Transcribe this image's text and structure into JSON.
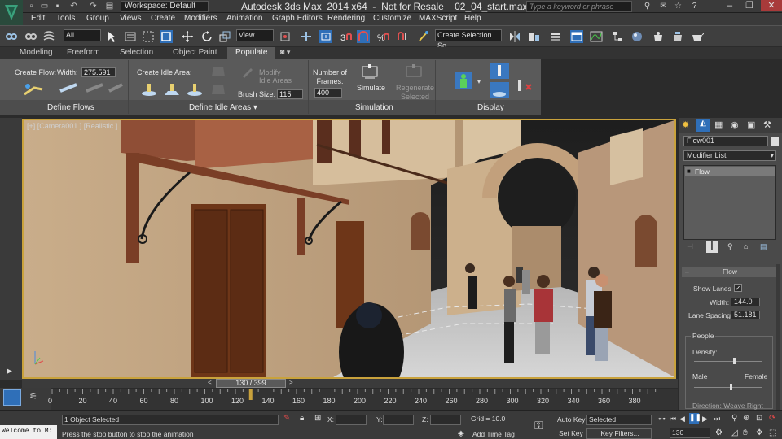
{
  "titlebar": {
    "title": "Autodesk 3ds Max  2014 x64  -  Not for Resale    02_04_start.max",
    "workspace": "Workspace: Default",
    "search_placeholder": "Type a keyword or phrase"
  },
  "menu": [
    "Edit",
    "Tools",
    "Group",
    "Views",
    "Create",
    "Modifiers",
    "Animation",
    "Graph Editors",
    "Rendering",
    "Customize",
    "MAXScript",
    "Help"
  ],
  "toolbar": {
    "filter": "All",
    "ref_coord": "View",
    "selection_set": "Create Selection Se"
  },
  "ribbon_tabs": [
    "Modeling",
    "Freeform",
    "Selection",
    "Object Paint",
    "Populate"
  ],
  "ribbon": {
    "create_flow": "Create Flow:",
    "width_label": "Width:",
    "width_value": "275.591",
    "create_idle_area": "Create Idle Area:",
    "modify_idle_areas": "Modify\nIdle Areas",
    "brush_size_label": "Brush Size:",
    "brush_size_value": "115",
    "number_of_frames": "Number of\nFrames:",
    "frames_value": "400",
    "simulate": "Simulate",
    "regenerate_selected": "Regenerate\nSelected",
    "footer_define_flows": "Define Flows",
    "footer_define_idle_areas": "Define Idle Areas ▾",
    "footer_simulation": "Simulation",
    "footer_display": "Display"
  },
  "viewport": {
    "label": "[+] [Camera001 ] [Realistic ]"
  },
  "command_panel": {
    "object_name": "Flow001",
    "modifier_list": "Modifier List",
    "stack_item": "Flow",
    "rollout_title": "Flow",
    "show_lanes": "Show Lanes",
    "width_label": "Width:",
    "width_value": "144.0",
    "lane_spacing_label": "Lane Spacing:",
    "lane_spacing_value": "51.181",
    "people_group": "People",
    "density": "Density:",
    "male": "Male",
    "female": "Female",
    "direction": "Direction: Weave Right"
  },
  "timeline": {
    "frame_display": "130 / 399",
    "current_frame": 130,
    "total_frames": 400,
    "ticks": [
      "0",
      "20",
      "40",
      "60",
      "80",
      "100",
      "120",
      "140",
      "160",
      "180",
      "200",
      "220",
      "240",
      "260",
      "280",
      "300",
      "320",
      "340",
      "360",
      "380"
    ]
  },
  "status": {
    "maxscript": "Welcome to M:",
    "selected": "1 Object Selected",
    "prompt": "Press the stop button to stop the animation",
    "x_label": "X:",
    "y_label": "Y:",
    "z_label": "Z:",
    "grid": "Grid = 10.0",
    "add_time_tag": "Add Time Tag",
    "auto_key": "Auto Key",
    "set_key": "Set Key",
    "key_mode": "Selected",
    "key_filters": "Key Filters...",
    "frame_field": "130"
  },
  "colors": {
    "viewport_border": "#c9a23c",
    "accent_blue": "#2f6fb8"
  }
}
